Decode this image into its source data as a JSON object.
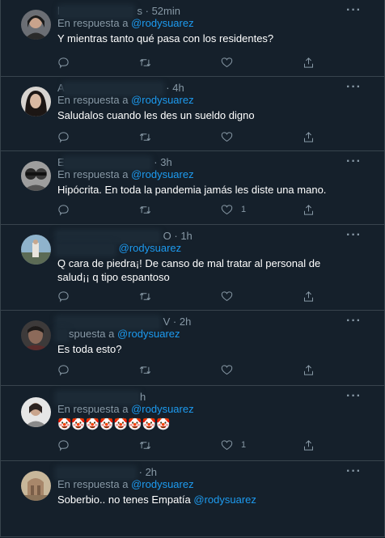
{
  "replies": [
    {
      "time": "52min",
      "name_visible": "l",
      "name_suffix": "s",
      "reply_prefix": "En respuesta a",
      "mention": "@rodysuarez",
      "text": "Y mientras tanto qué pasa con los residentes?",
      "likes": "",
      "avatar_color": "#6b6e74"
    },
    {
      "time": "4h",
      "name_visible": "A",
      "name_suffix": "",
      "reply_prefix": "En respuesta a",
      "mention": "@rodysuarez",
      "text": "Saludalos cuando les des un sueldo digno",
      "likes": "",
      "avatar_color": "#3e3a38"
    },
    {
      "time": "3h",
      "name_visible": "E",
      "name_suffix": "",
      "reply_prefix": "En respuesta a",
      "mention": "@rodysuarez",
      "text": "Hipócrita. En toda la pandemia jamás les diste una mano.",
      "likes": "1",
      "avatar_color": "#4a4a4a"
    },
    {
      "time": "1h",
      "name_visible": "",
      "name_suffix": "O",
      "reply_prefix": "",
      "mention": "@rodysuarez",
      "text": "Q cara de piedra¡! De canso de mal tratar al personal de salud¡¡ q tipo espantoso",
      "likes": "",
      "avatar_color": "#7f9cb0"
    },
    {
      "time": "2h",
      "name_visible": "",
      "name_suffix": "V",
      "reply_prefix": "spuesta a",
      "mention": "@rodysuarez",
      "text": "Es toda esto?",
      "likes": "",
      "avatar_color": "#5a4a44"
    },
    {
      "time": "h",
      "name_visible": "",
      "name_suffix": "",
      "reply_prefix": "En respuesta a",
      "mention": "@rodysuarez",
      "text": "🤡🤡🤡🤡🤡🤡🤡🤡",
      "likes": "1",
      "avatar_color": "#9a9a9a"
    },
    {
      "time": "2h",
      "name_visible": "",
      "name_suffix": "",
      "reply_prefix": "En respuesta a",
      "mention": "@rodysuarez",
      "text": "Soberbio.. no tenes Empatía",
      "text_mention": "@rodysuarez",
      "likes": "",
      "avatar_color": "#a0866a"
    }
  ],
  "icons": {
    "more": "more-icon",
    "reply": "reply-icon",
    "retweet": "retweet-icon",
    "like": "like-icon",
    "share": "share-icon"
  },
  "colors": {
    "background": "#15202b",
    "border": "#38444d",
    "secondary_text": "#8899a6",
    "mention": "#1d9bf0"
  }
}
